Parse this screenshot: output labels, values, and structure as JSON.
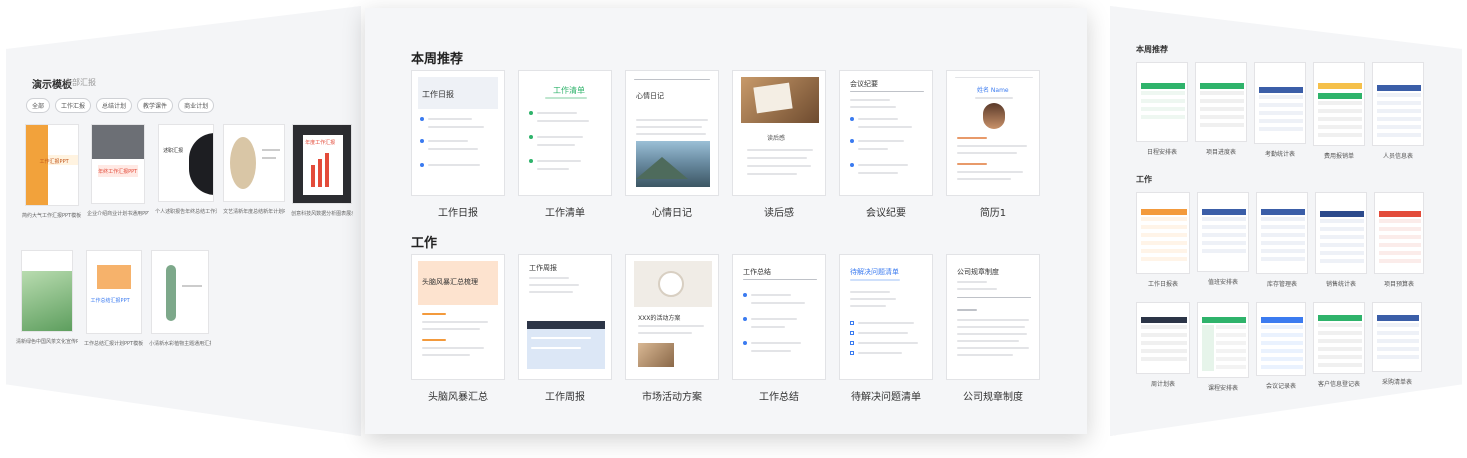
{
  "center": {
    "section1_title": "本周推荐",
    "section2_title": "工作",
    "weekly": [
      {
        "label": "工作日报",
        "doc_title": "工作日报"
      },
      {
        "label": "工作清单",
        "doc_title": "工作清单"
      },
      {
        "label": "心情日记",
        "doc_title": "心情日记"
      },
      {
        "label": "读后感",
        "doc_title": "读后感"
      },
      {
        "label": "会议纪要",
        "doc_title": "会议纪要"
      },
      {
        "label": "简历1",
        "doc_title": "姓名 Name"
      }
    ],
    "work": [
      {
        "label": "头脑风暴汇总",
        "doc_title": "头脑风暴汇总梳理"
      },
      {
        "label": "工作周报",
        "doc_title": "工作周报"
      },
      {
        "label": "市场活动方案",
        "doc_title": "XXX的活动方案"
      },
      {
        "label": "工作总结",
        "doc_title": "工作总结"
      },
      {
        "label": "待解决问题清单",
        "doc_title": "待解决问题清单"
      },
      {
        "label": "公司规章制度",
        "doc_title": "公司规章制度"
      }
    ]
  },
  "left": {
    "heading": "演示模板",
    "heading_sub": "全部汇报",
    "tabs": [
      "全部",
      "工作汇报",
      "总结计划",
      "教学课件",
      "商业计划"
    ],
    "row1_captions": [
      "简约大气工作汇报PPT模板",
      "企业介绍商业计划书通用PPT模板",
      "个人述职报告年终总结工作汇报",
      "文艺清新年度总结新年计划PPT模板",
      "创意科技风数据分析图表展示汇报"
    ],
    "row1_overlay": [
      "工作汇报PPT",
      "年终工作汇报PPT",
      "述职汇报",
      "",
      "年度工作汇报"
    ],
    "row2_captions": [
      "清新绿色中国风茶文化宣传PPT模板",
      "工作总结汇报计划PPT模板",
      "小清新水彩植物主题通用汇报PPT..."
    ],
    "row2_overlay": [
      "",
      "工作总结汇报PPT",
      ""
    ]
  },
  "right": {
    "heading1": "本周推荐",
    "heading2": "工作",
    "row1": [
      "日程安排表",
      "项目进度表",
      "考勤统计表",
      "费用报销单",
      "人员信息表"
    ],
    "row2": [
      "工作日报表",
      "值班安排表",
      "库存管理表",
      "销售统计表",
      "项目预算表"
    ],
    "row3": [
      "周计划表",
      "课程安排表",
      "会议记录表",
      "客户信息登记表",
      "采购清单表"
    ]
  },
  "colors": {
    "accent_blue": "#3b7bf0",
    "accent_green": "#2fb36b",
    "accent_orange": "#f39a3c",
    "accent_red": "#e34b3a",
    "panel_bg": "#f5f6f8"
  }
}
